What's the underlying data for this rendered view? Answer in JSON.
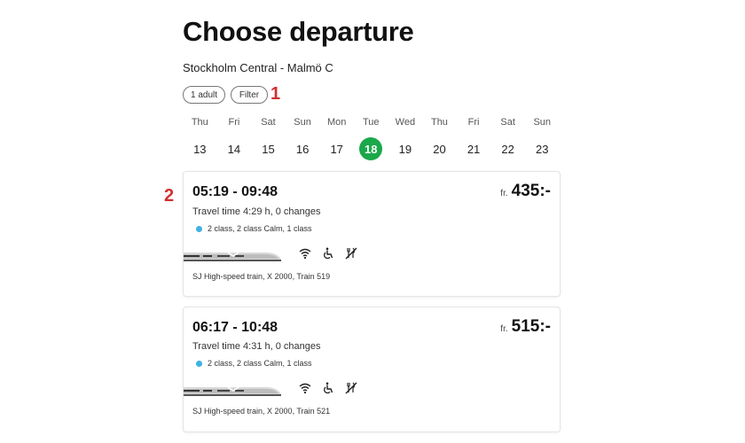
{
  "page": {
    "title": "Choose departure",
    "route": "Stockholm Central - Malmö C"
  },
  "filters": {
    "passengers": "1 adult",
    "filter": "Filter"
  },
  "annotations": [
    "1",
    "2"
  ],
  "calendar": {
    "days": [
      {
        "dow": "Thu",
        "num": "13"
      },
      {
        "dow": "Fri",
        "num": "14"
      },
      {
        "dow": "Sat",
        "num": "15"
      },
      {
        "dow": "Sun",
        "num": "16"
      },
      {
        "dow": "Mon",
        "num": "17"
      },
      {
        "dow": "Tue",
        "num": "18",
        "selected": true
      },
      {
        "dow": "Wed",
        "num": "19"
      },
      {
        "dow": "Thu",
        "num": "20"
      },
      {
        "dow": "Fri",
        "num": "21"
      },
      {
        "dow": "Sat",
        "num": "22"
      },
      {
        "dow": "Sun",
        "num": "23"
      }
    ],
    "selected_color": "#1aa84a"
  },
  "departures": [
    {
      "times": "05:19 - 09:48",
      "price_prefix": "fr.",
      "price": "435:-",
      "travel_time": "Travel time 4:29 h, 0 changes",
      "classes": "2 class, 2 class Calm, 1 class",
      "service": "SJ High-speed train, X 2000, Train 519",
      "features": [
        "wifi-icon",
        "wheelchair-icon",
        "no-food-icon"
      ]
    },
    {
      "times": "06:17 - 10:48",
      "price_prefix": "fr.",
      "price": "515:-",
      "travel_time": "Travel time 4:31 h, 0 changes",
      "classes": "2 class, 2 class Calm, 1 class",
      "service": "SJ High-speed train, X 2000, Train 521",
      "features": [
        "wifi-icon",
        "wheelchair-icon",
        "no-food-icon"
      ]
    }
  ],
  "colors": {
    "class_dot": "#3fb2e2",
    "annotation": "#d12f2f"
  }
}
